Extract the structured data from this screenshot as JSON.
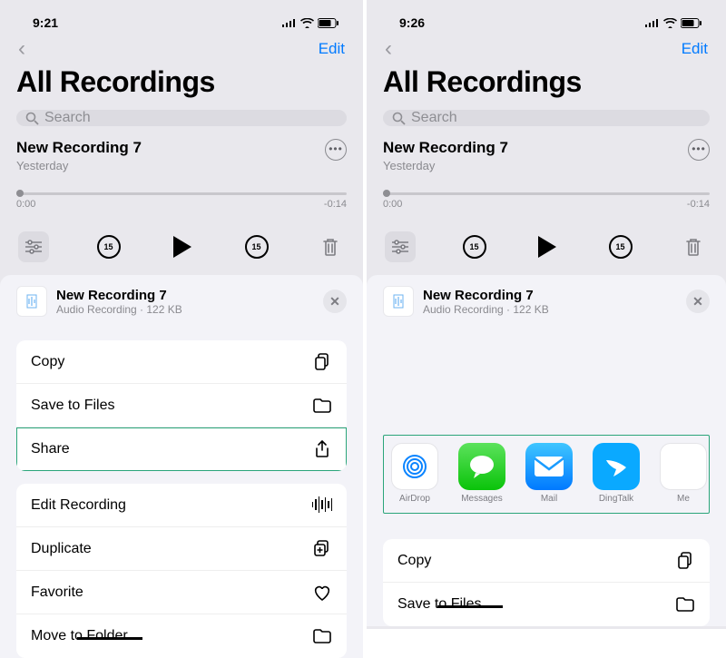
{
  "left": {
    "status": {
      "time": "9:21"
    },
    "nav": {
      "edit": "Edit"
    },
    "title": "All Recordings",
    "search": {
      "placeholder": "Search"
    },
    "recording": {
      "title": "New Recording 7",
      "subtitle": "Yesterday",
      "time_start": "0:00",
      "time_end": "-0:14",
      "skip_seconds": "15"
    },
    "sheet": {
      "title": "New Recording 7",
      "meta": "Audio Recording · 122 KB",
      "actions": {
        "copy": "Copy",
        "save": "Save to Files",
        "share": "Share",
        "edit": "Edit Recording",
        "duplicate": "Duplicate",
        "favorite": "Favorite",
        "move": "Move to Folder"
      }
    }
  },
  "right": {
    "status": {
      "time": "9:26"
    },
    "nav": {
      "edit": "Edit"
    },
    "title": "All Recordings",
    "search": {
      "placeholder": "Search"
    },
    "recording": {
      "title": "New Recording 7",
      "subtitle": "Yesterday",
      "time_start": "0:00",
      "time_end": "-0:14",
      "skip_seconds": "15"
    },
    "sheet": {
      "title": "New Recording 7",
      "meta": "Audio Recording · 122 KB",
      "apps": {
        "airdrop": "AirDrop",
        "messages": "Messages",
        "mail": "Mail",
        "dingtalk": "DingTalk",
        "me": "Me"
      },
      "actions": {
        "copy": "Copy",
        "save": "Save to Files"
      }
    }
  }
}
